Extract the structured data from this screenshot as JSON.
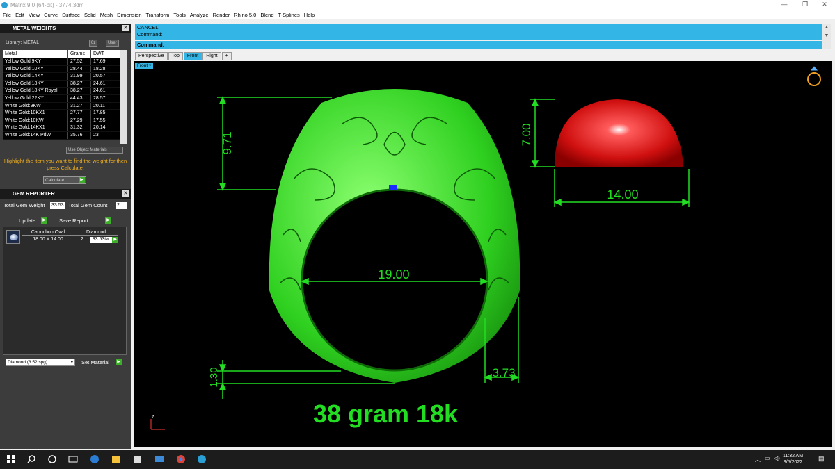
{
  "window": {
    "title": "Matrix 9.0 (64-bit) - 3774.3dm"
  },
  "menu": [
    "File",
    "Edit",
    "View",
    "Curve",
    "Surface",
    "Solid",
    "Mesh",
    "Dimension",
    "Transform",
    "Tools",
    "Analyze",
    "Render",
    "Rhino 5.0",
    "Blend",
    "T-Splines",
    "Help"
  ],
  "metal_weights": {
    "header": "METAL WEIGHTS",
    "library_label": "Library: METAL",
    "btn_unit1": "0z",
    "btn_unit2": "User",
    "columns": [
      "Metal",
      "Grams",
      "DWT"
    ],
    "rows": [
      [
        "Yellow Gold:9KY",
        "27.52",
        "17.69"
      ],
      [
        "Yellow Gold:10KY",
        "28.44",
        "18.28"
      ],
      [
        "Yellow Gold:14KY",
        "31.99",
        "20.57"
      ],
      [
        "Yellow Gold:18KY",
        "38.27",
        "24.61"
      ],
      [
        "Yellow Gold:18KY Royal",
        "38.27",
        "24.61"
      ],
      [
        "Yellow Gold:22KY",
        "44.43",
        "28.57"
      ],
      [
        "White Gold:9KW",
        "31.27",
        "20.11"
      ],
      [
        "White Gold:10KX1",
        "27.77",
        "17.85"
      ],
      [
        "White Gold:10KW",
        "27.29",
        "17.55"
      ],
      [
        "White Gold:14KX1",
        "31.32",
        "20.14"
      ],
      [
        "White Gold:14K PdW",
        "35.76",
        "23"
      ]
    ],
    "use_object_materials": "Use Object Materials",
    "hint": "Highlight the item you want to find the weight for then press Calculate.",
    "calculate": "Calculate"
  },
  "gem_reporter": {
    "header": "GEM REPORTER",
    "total_weight_label": "Total Gem Weight",
    "total_weight_value": "33.53",
    "total_count_label": "Total Gem Count",
    "total_count_value": "2",
    "update": "Update",
    "save_report": "Save Report",
    "gem": {
      "shape": "Cabochon Oval",
      "size": "18.00 X 14.00",
      "type": "Diamond",
      "count": "2",
      "weight": "33.53tw"
    },
    "material": "Diamond    (3.52 spg)",
    "set_material": "Set Material"
  },
  "command": {
    "line1": "CANCEL",
    "line2": "Command:",
    "prompt": "Command:"
  },
  "viewport_tabs": [
    "Perspective",
    "Top",
    "Front",
    "Right",
    "+"
  ],
  "viewport_label": "Front",
  "dimensions": {
    "left_height": "9.71",
    "stone_height": "7.00",
    "stone_width": "14.00",
    "inner_diameter": "19.00",
    "shank_bottom": "1.30",
    "shank_side": "3.73"
  },
  "annotation": "38 gram 18k",
  "axis_label": "z",
  "tray": {
    "time": "11:32 AM",
    "date": "9/5/2022"
  },
  "colors": {
    "accent": "#33b5e5",
    "dim": "#22dd22",
    "ring": "#3fe030",
    "stone": "#e51b1b"
  }
}
